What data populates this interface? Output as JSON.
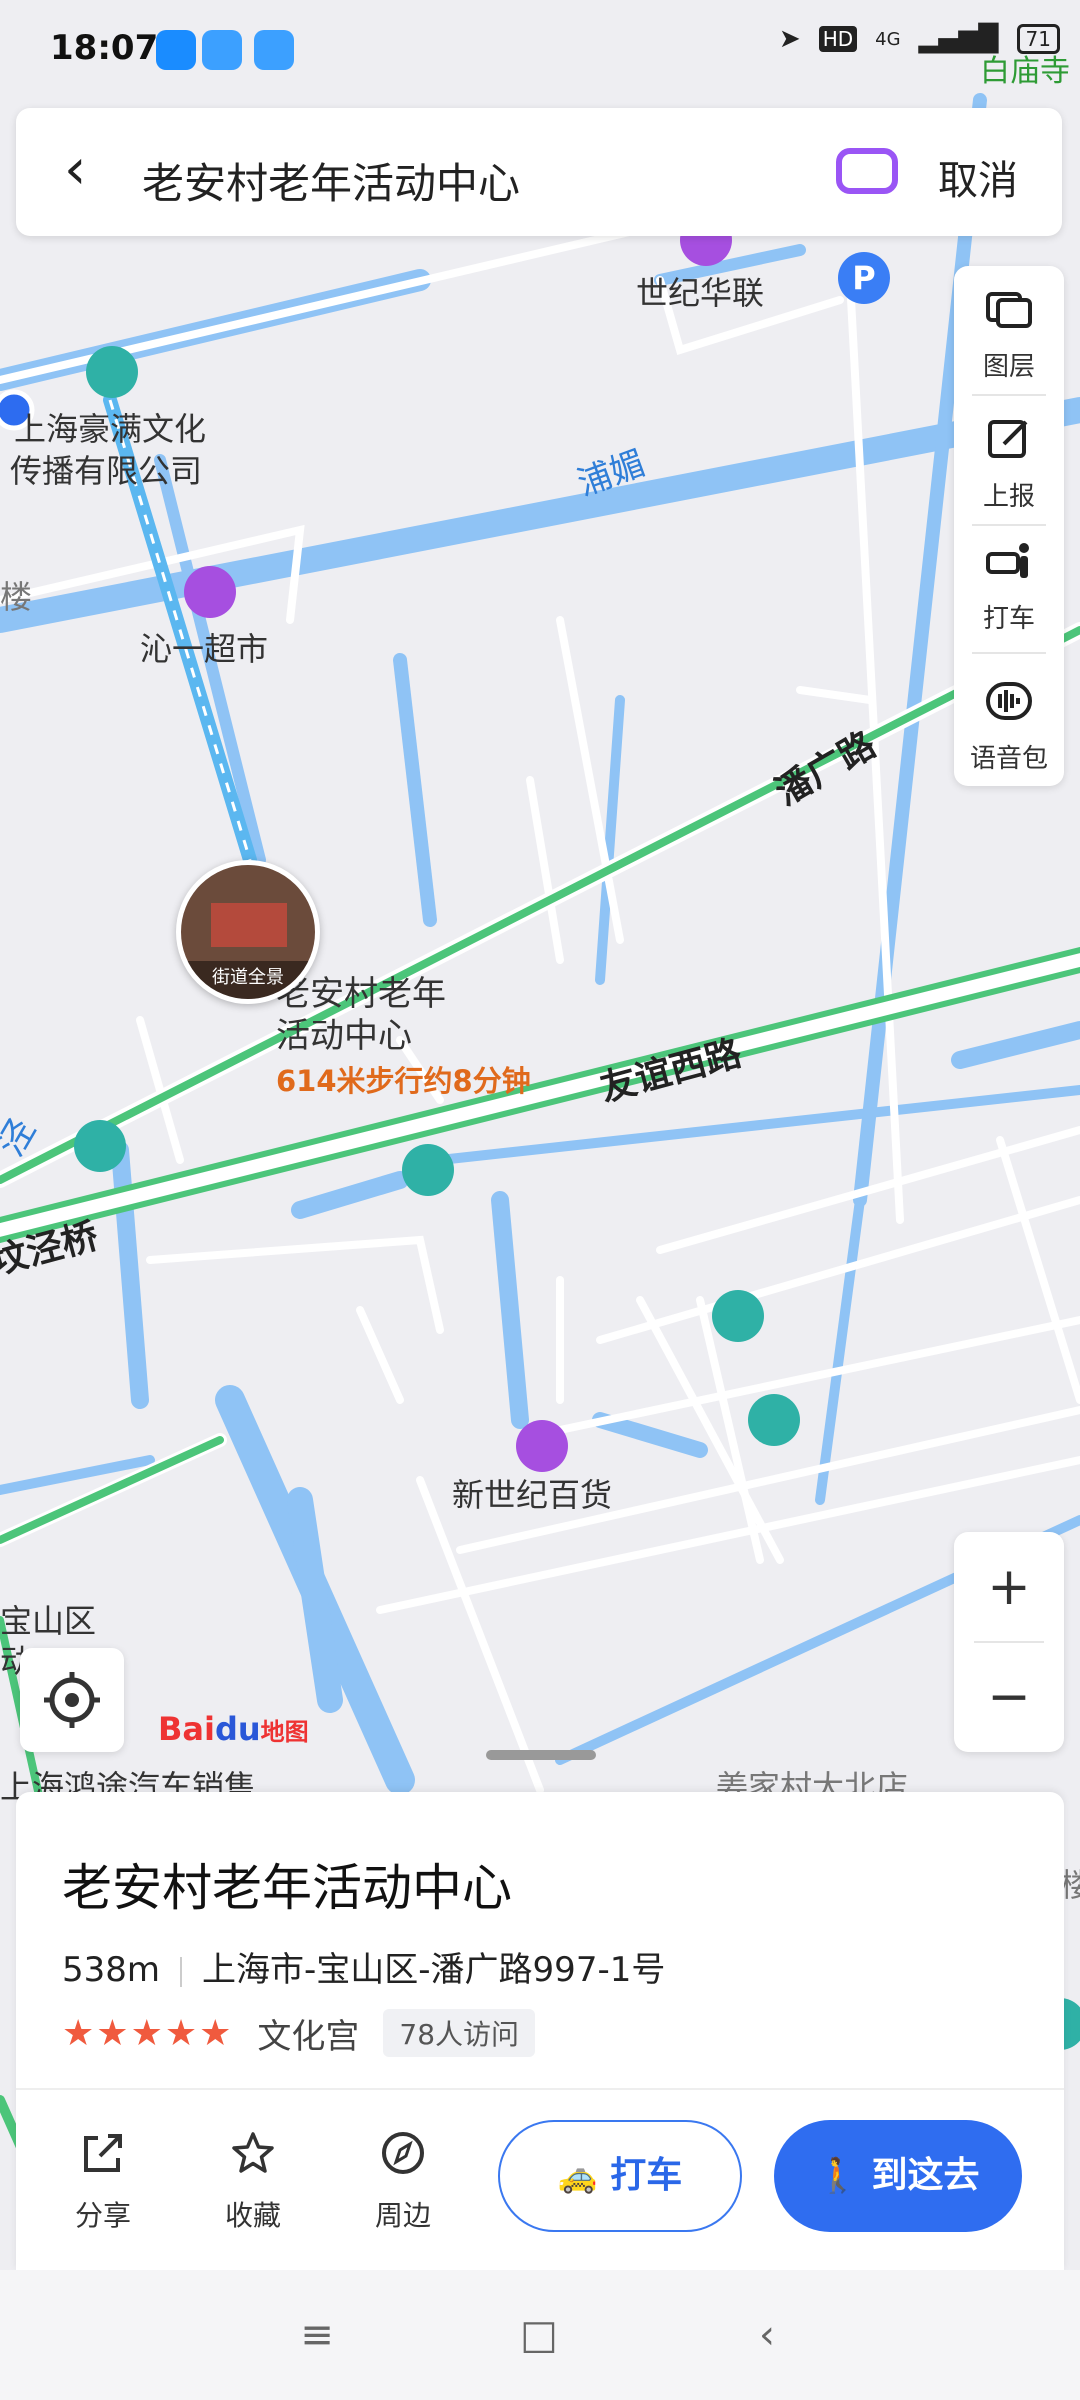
{
  "status_bar": {
    "time": "18:07",
    "network": "HD",
    "signal": "4G",
    "battery": "71"
  },
  "search": {
    "query": "老安村老年活动中心",
    "cancel_label": "取消"
  },
  "toolbar": {
    "layers": "图层",
    "report": "上报",
    "taxi": "打车",
    "voice": "语音包"
  },
  "map": {
    "labels": {
      "temple": "白庙寺",
      "shijihualian": "世纪华联",
      "company_line1": "上海豪满文化",
      "company_line2": "传播有限公司",
      "supermarket": "沁一超市",
      "building_left": "楼",
      "poi_name_line1": "老安村老年",
      "poi_name_line2": "活动中心",
      "walk_distance": "614米步行约8分钟",
      "store": "新世纪百货",
      "district_line1": "宝山区",
      "district_line2": "动",
      "car_sales": "上海鸿途汽车销售",
      "village": "姜家村大北店",
      "street_view": "街道全景",
      "building_right": "楼"
    },
    "roads": {
      "panguang": "潘广路",
      "youyi": "友谊西路",
      "qiao": "坟泾桥",
      "pumei": "浦媚",
      "left_road": "泾"
    },
    "parking": "P",
    "logo": {
      "bai": "Bai",
      "du": "du",
      "map": "地图"
    }
  },
  "zoom": {
    "plus": "+",
    "minus": "−"
  },
  "place": {
    "title": "老安村老年活动中心",
    "distance": "538m",
    "address": "上海市-宝山区-潘广路997-1号",
    "rating": 5,
    "category": "文化宫",
    "visits": "78人访问"
  },
  "actions": {
    "share": "分享",
    "favorite": "收藏",
    "nearby": "周边",
    "taxi": "打车",
    "go": "到这去"
  },
  "colors": {
    "accent": "#2f6df0",
    "road_green": "#4cc57a",
    "water": "#8fc3f5",
    "distance_orange": "#e06a1c"
  }
}
